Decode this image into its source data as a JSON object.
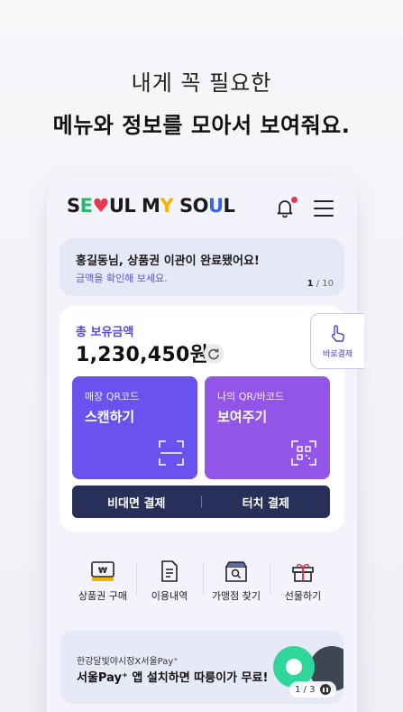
{
  "headline": {
    "line1": "내게 꼭 필요한",
    "line2": "메뉴와 정보를 모아서 보여줘요."
  },
  "app": {
    "logo": {
      "p1": "S",
      "p2": "E",
      "p3": "♥",
      "p4": "UL M",
      "p5": "Y",
      "p6": " SO",
      "p7": "U",
      "p8": "L"
    },
    "notice": {
      "title": "홍길동님, 상품권 이관이 완료됐어요!",
      "subtitle": "금액을 확인해 보세요.",
      "page_current": "1",
      "page_total": " / 10"
    },
    "balance": {
      "label": "총 보유금액",
      "amount": "1,230,450원"
    },
    "tiles": {
      "scan": {
        "small": "매장 QR코드",
        "big": "스캔하기"
      },
      "show": {
        "small": "나의 QR/바코드",
        "big": "보여주기"
      }
    },
    "paybar": {
      "remote": "비대면 결제",
      "touch": "터치 결제"
    },
    "quick_pay_label": "바로결제",
    "quick_menu": [
      {
        "label": "상품권 구매",
        "icon": "voucher-icon"
      },
      {
        "label": "이용내역",
        "icon": "document-icon"
      },
      {
        "label": "가맹점 찾기",
        "icon": "store-search-icon"
      },
      {
        "label": "선물하기",
        "icon": "gift-icon"
      }
    ],
    "banner": {
      "small": "한강달빛야시장X서울Pay⁺",
      "big": "서울Pay⁺ 앱 설치하면 따릉이가 무료!",
      "page": "1 / 3"
    }
  },
  "colors": {
    "accent": "#6a52ee",
    "purple": "#9354e8",
    "navy": "#28305a",
    "alert": "#e53950"
  }
}
